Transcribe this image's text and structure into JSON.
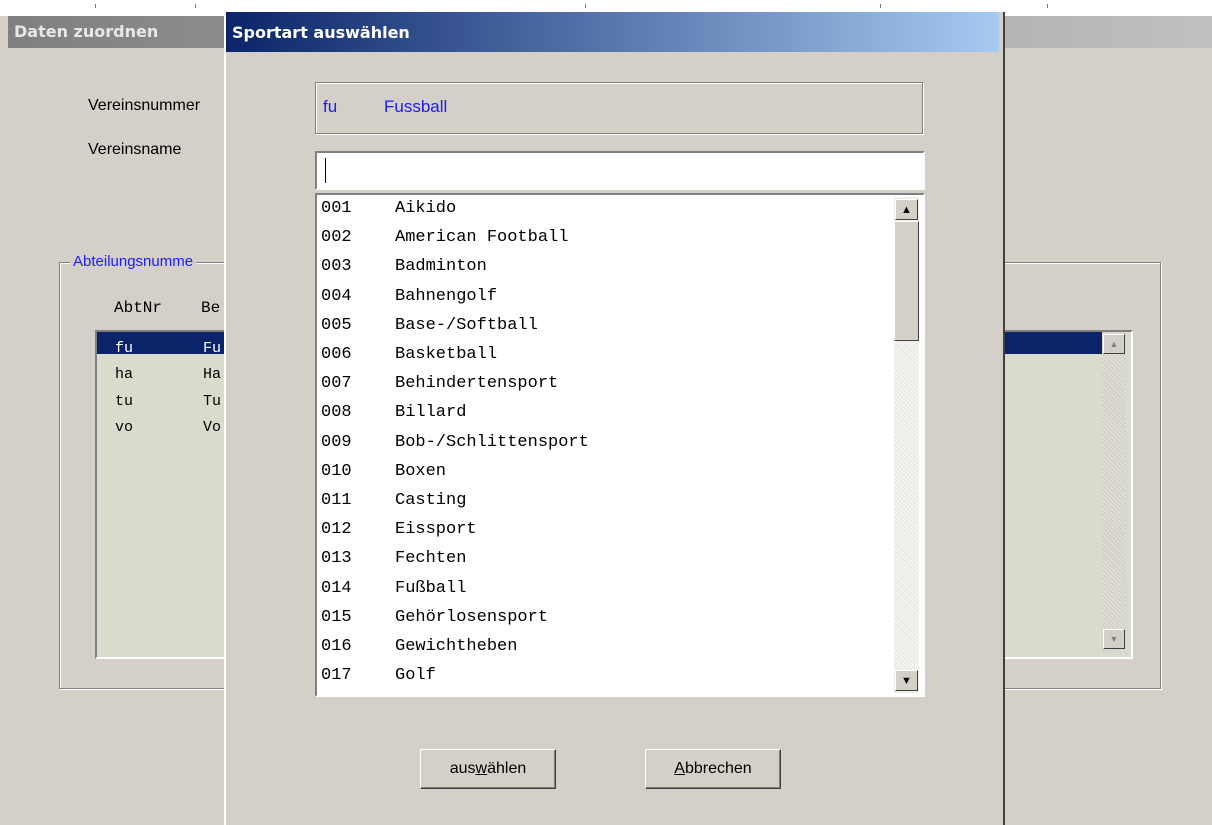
{
  "background_window": {
    "title": "Daten zuordnen",
    "vereinsnummer_label": "Vereinsnummer",
    "vereinsname_label": "Vereinsname",
    "group_label": "Abteilungsnumme",
    "col_abtnr": "AbtNr",
    "col_be": "Be",
    "rows": [
      {
        "code": "fu",
        "name": "Fu"
      },
      {
        "code": "ha",
        "name": "Ha"
      },
      {
        "code": "tu",
        "name": "Tu"
      },
      {
        "code": "vo",
        "name": "Vo"
      }
    ]
  },
  "dialog": {
    "title": "Sportart auswählen",
    "selected_code": "fu",
    "selected_name": "Fussball",
    "filter_value": "",
    "items": [
      {
        "code": "001",
        "name": "Aikido"
      },
      {
        "code": "002",
        "name": "American Football"
      },
      {
        "code": "003",
        "name": "Badminton"
      },
      {
        "code": "004",
        "name": "Bahnengolf"
      },
      {
        "code": "005",
        "name": "Base-/Softball"
      },
      {
        "code": "006",
        "name": "Basketball"
      },
      {
        "code": "007",
        "name": "Behindertensport"
      },
      {
        "code": "008",
        "name": "Billard"
      },
      {
        "code": "009",
        "name": "Bob-/Schlittensport"
      },
      {
        "code": "010",
        "name": "Boxen"
      },
      {
        "code": "011",
        "name": "Casting"
      },
      {
        "code": "012",
        "name": "Eissport"
      },
      {
        "code": "013",
        "name": "Fechten"
      },
      {
        "code": "014",
        "name": "Fußball"
      },
      {
        "code": "015",
        "name": "Gehörlosensport"
      },
      {
        "code": "016",
        "name": "Gewichtheben"
      },
      {
        "code": "017",
        "name": "Golf"
      }
    ],
    "buttons": {
      "select_pre": "aus",
      "select_mnemonic": "w",
      "select_post": "ählen",
      "cancel_mnemonic": "A",
      "cancel_post": "bbrechen"
    }
  },
  "icons": {
    "scroll_up": "scroll-up-arrow-icon",
    "scroll_down": "scroll-down-arrow-icon"
  },
  "colors": {
    "title_active_start": "#0a246a",
    "title_active_end": "#a6caf0",
    "selected_text": "#1a1aff",
    "list_background_bg": "#d8dccc"
  }
}
